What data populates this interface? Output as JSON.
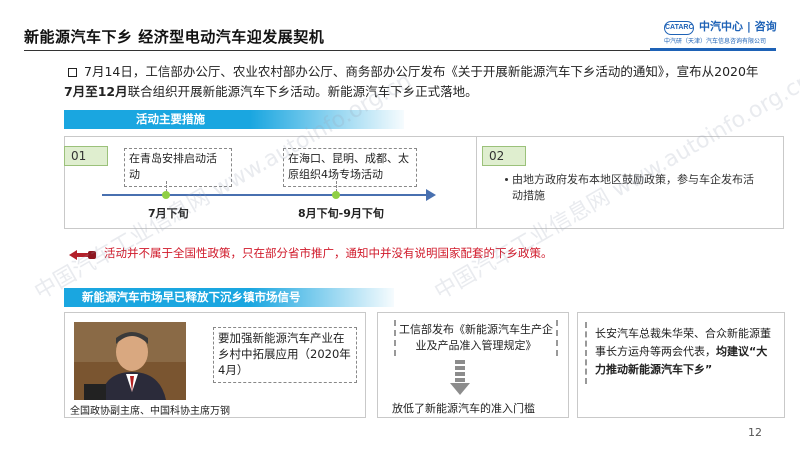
{
  "header": {
    "title": "新能源汽车下乡 经济型电动汽车迎发展契机",
    "logo_badge": "CATARC",
    "logo_name": "中汽中心 | 咨询",
    "logo_sub": "中汽研（天津）汽车信息咨询有限公司"
  },
  "intro": {
    "part1": "7月14日，工信部办公厅、农业农村部办公厅、商务部办公厅发布《关于开展新能源汽车下乡活动的通知》，宣布从2020年",
    "bold": "7月至12月",
    "part2": "联合组织开展新能源汽车下乡活动。新能源汽车下乡正式落地。"
  },
  "section1": {
    "ribbon": "活动主要措施",
    "panel1_num": "01",
    "panel2_num": "02",
    "note1": "在青岛安排启动活动",
    "note2": "在海口、昆明、成都、太原组织4场专场活动",
    "timeline_label1": "7月下旬",
    "timeline_label2": "8月下旬-9月下旬",
    "panel2_text": "由地方政府发布本地区鼓励政策，参与车企发布活动措施"
  },
  "warning": "活动并不属于全国性政策，只在部分省市推广，通知中并没有说明国家配套的下乡政策。",
  "section2": {
    "ribbon": "新能源汽车市场早已释放下沉乡镇市场信号",
    "photo_caption": "全国政协副主席、中国科协主席万钢",
    "quote": "要加强新能源汽车产业在乡村中拓展应用（2020年4月）",
    "p4_top": "工信部发布《新能源汽车生产企业及产品准入管理规定》",
    "p4_bottom": "放低了新能源汽车的准入门槛",
    "p5_text": "长安汽车总裁朱华荣、合众新能源董事长方运舟等两会代表，",
    "p5_bold": "均建议“大力推动新能源汽车下乡”"
  },
  "page_number": "12",
  "watermark_text": "中国汽车工业信息网 www.autoinfo.org.cn",
  "colors": {
    "ribbon": "#1aa6e0",
    "accent": "#1e62b6",
    "warning": "#d0192a",
    "timeline": "#4870b0",
    "dot": "#8fcf45"
  }
}
